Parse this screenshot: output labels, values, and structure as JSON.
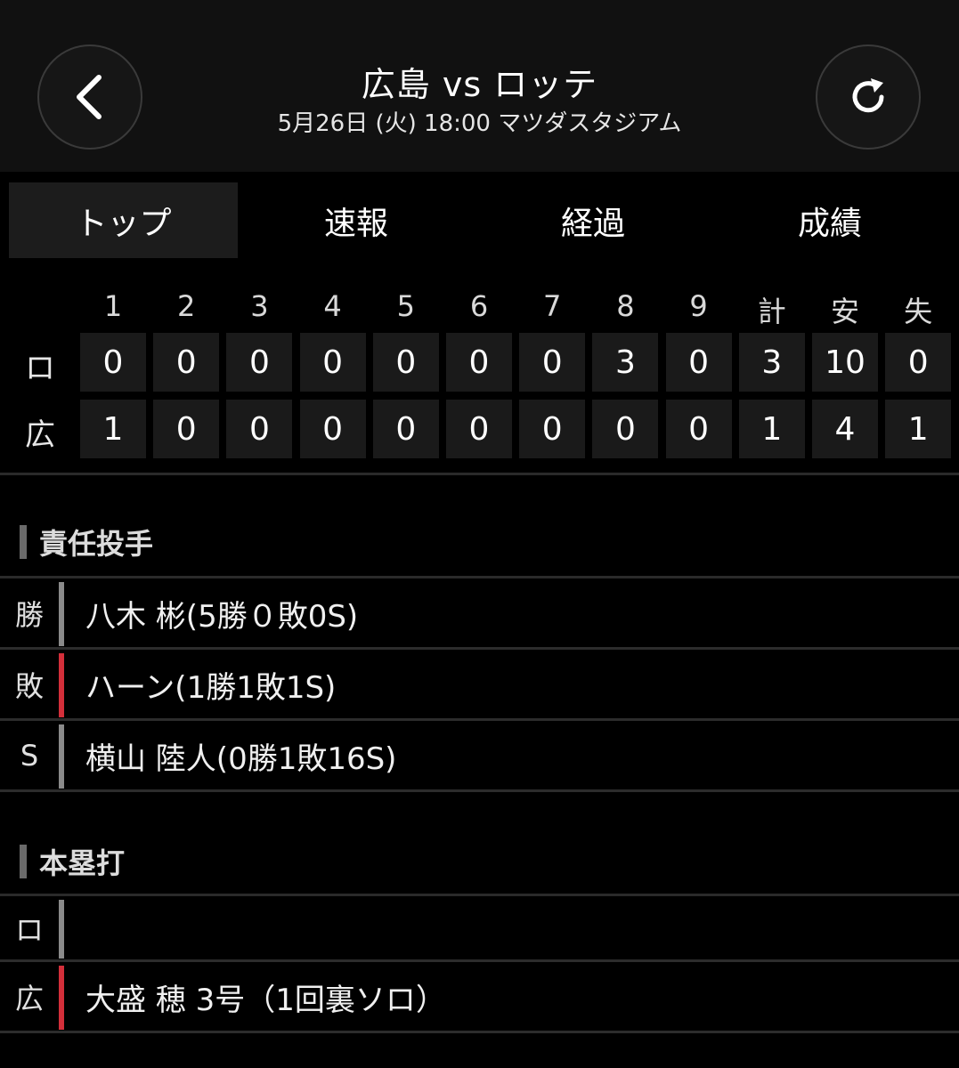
{
  "header": {
    "title": "広島 vs ロッテ",
    "subtitle": "5月26日 (火) 18:00 マツダスタジアム",
    "back_icon": "chevron-left-icon",
    "reload_icon": "reload-icon"
  },
  "tabs": [
    {
      "label": "トップ",
      "active": true
    },
    {
      "label": "速報",
      "active": false
    },
    {
      "label": "経過",
      "active": false
    },
    {
      "label": "成績",
      "active": false
    }
  ],
  "scoreboard": {
    "columns": [
      "1",
      "2",
      "3",
      "4",
      "5",
      "6",
      "7",
      "8",
      "9",
      "計",
      "安",
      "失"
    ],
    "teams": [
      {
        "label": "ロ",
        "values": [
          "0",
          "0",
          "0",
          "0",
          "0",
          "0",
          "0",
          "3",
          "0",
          "3",
          "10",
          "0"
        ]
      },
      {
        "label": "広",
        "values": [
          "1",
          "0",
          "0",
          "0",
          "0",
          "0",
          "0",
          "0",
          "0",
          "1",
          "4",
          "1"
        ]
      }
    ]
  },
  "pitchers": {
    "title": "責任投手",
    "rows": [
      {
        "label": "勝",
        "text": "八木 彬(5勝０敗0S)",
        "accent": "#8a8a8a"
      },
      {
        "label": "敗",
        "text": "ハーン(1勝1敗1S)",
        "accent": "#d32f3a"
      },
      {
        "label": "S",
        "text": "横山 陸人(0勝1敗16S)",
        "accent": "#8a8a8a"
      }
    ]
  },
  "homeruns": {
    "title": "本塁打",
    "rows": [
      {
        "label": "ロ",
        "text": "",
        "accent": "#8a8a8a"
      },
      {
        "label": "広",
        "text": "大盛 穂 3号（1回裏ソロ）",
        "accent": "#d32f3a"
      }
    ]
  }
}
